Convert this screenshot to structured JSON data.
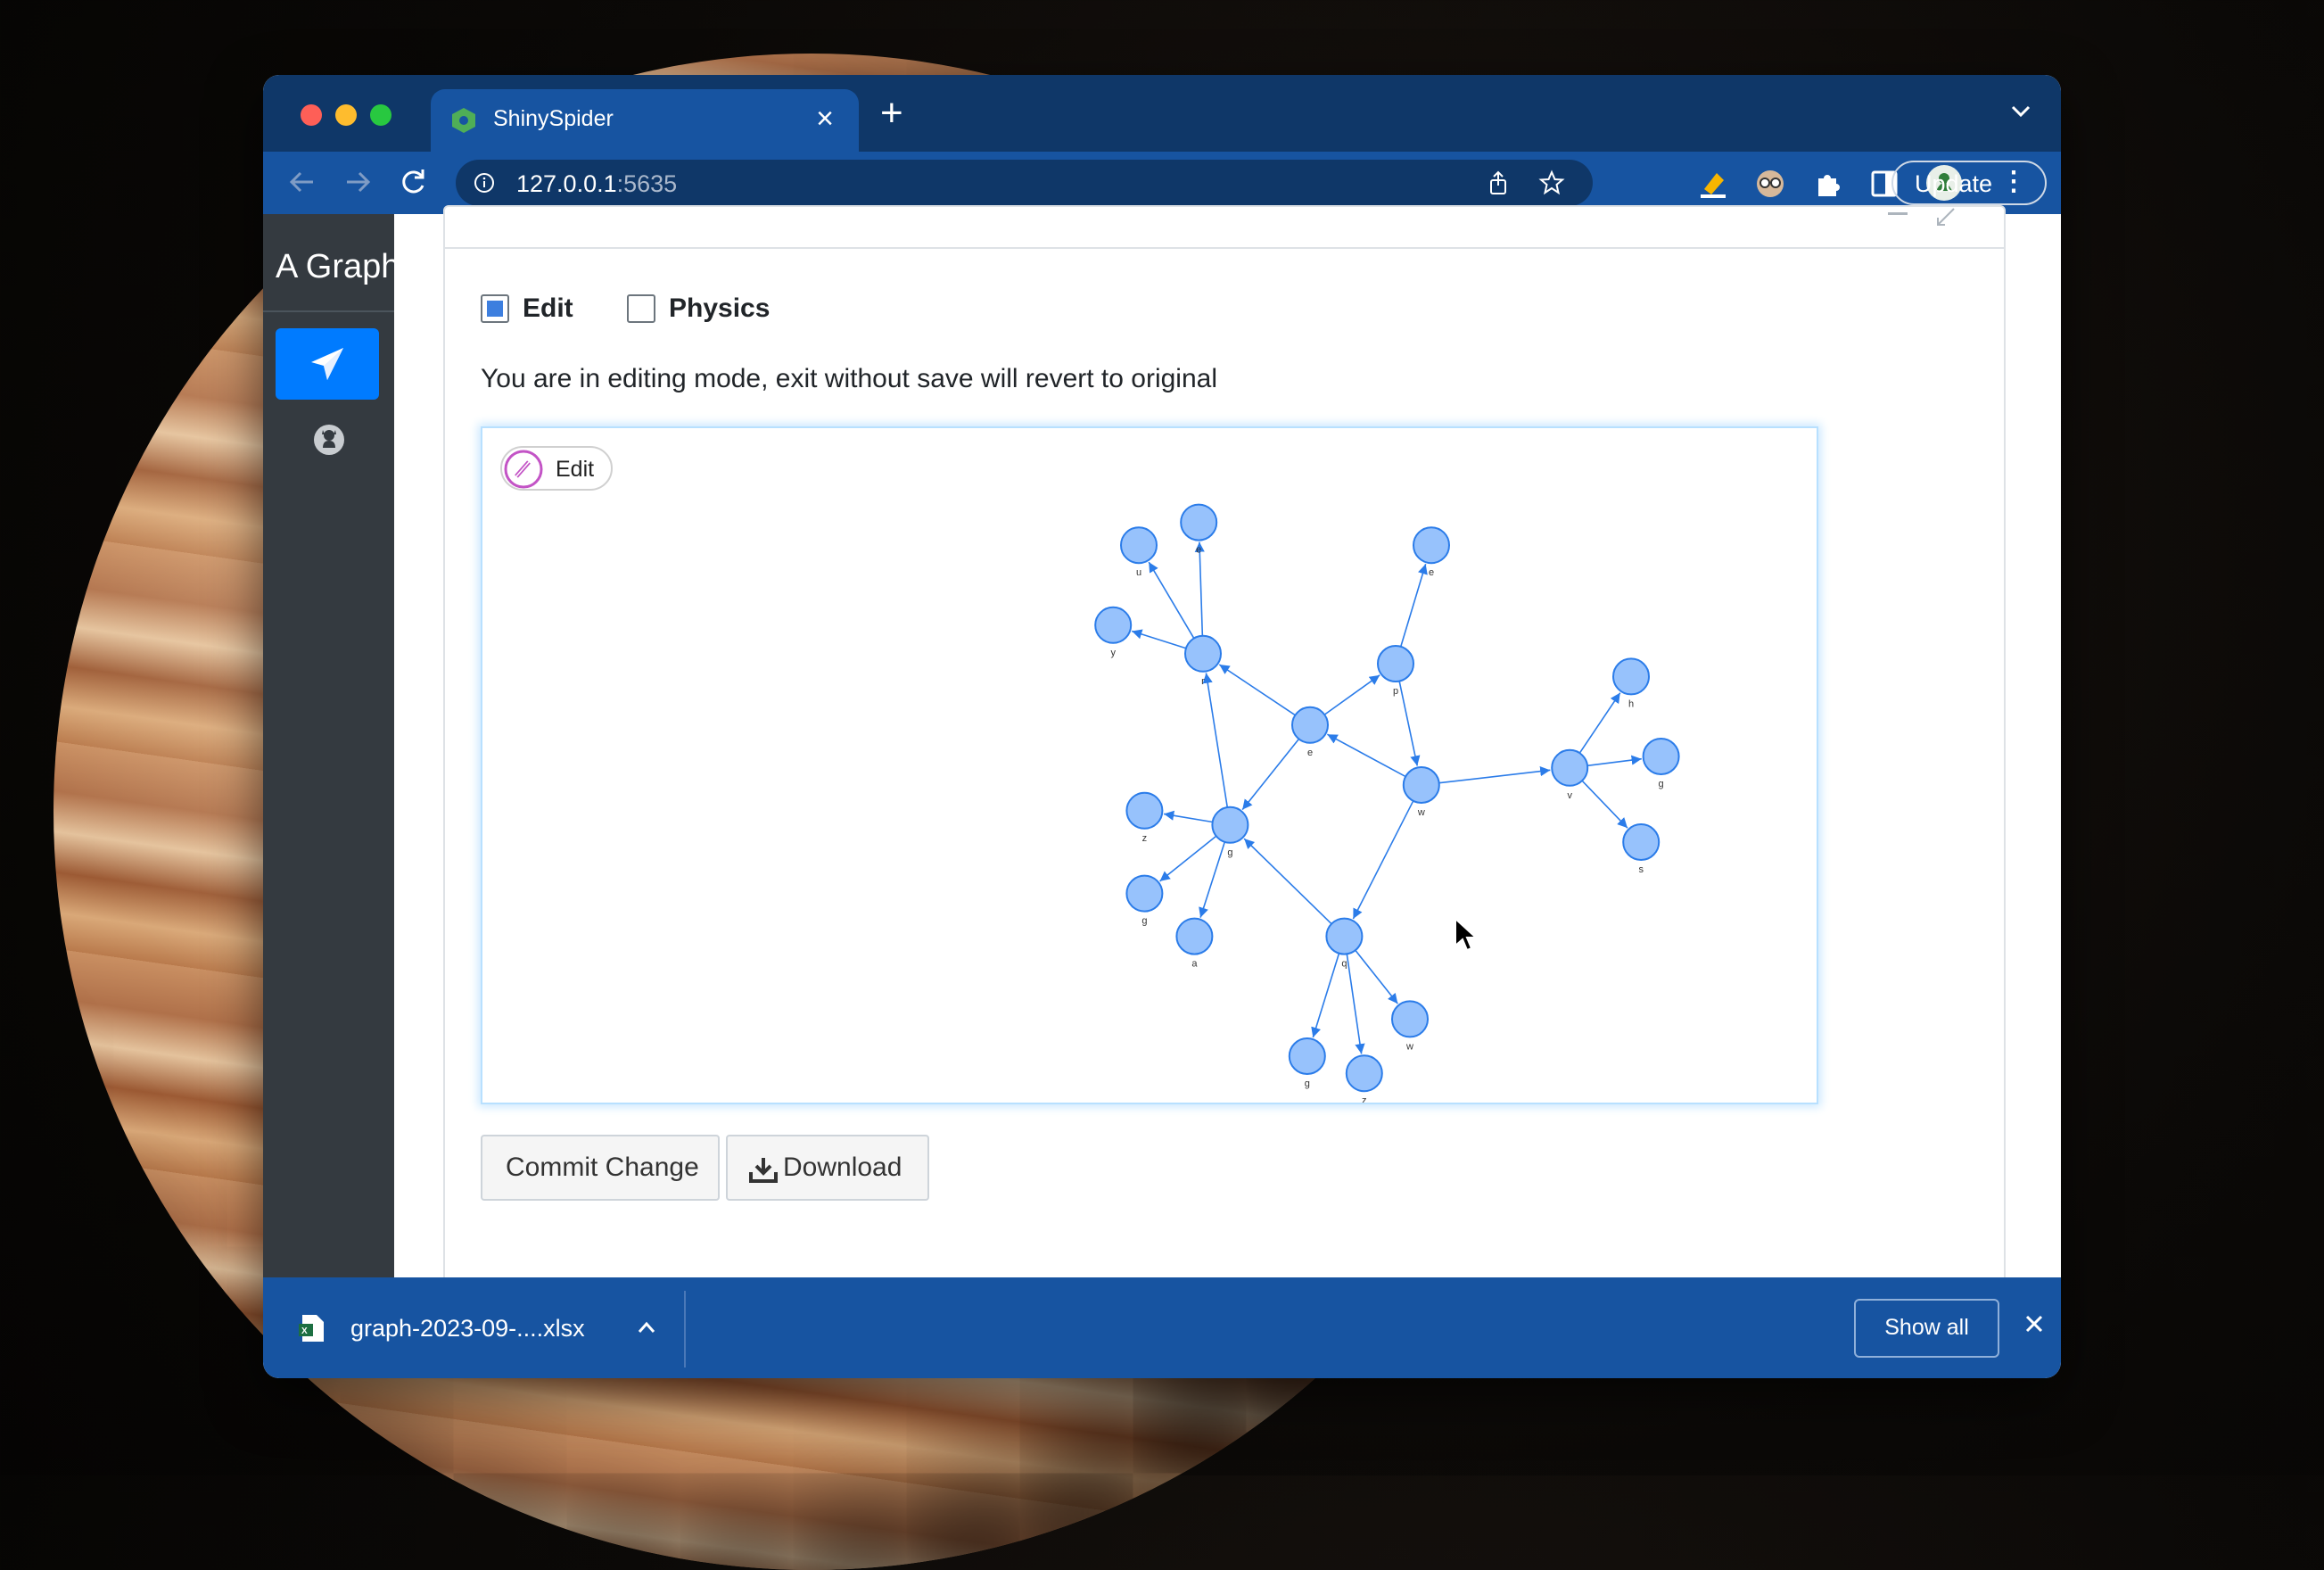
{
  "browser": {
    "tab_title": "ShinySpider",
    "tab_close": "×",
    "new_tab": "+",
    "url_host": "127.0.0.1",
    "url_port": ":5635",
    "update_label": "Update",
    "menu_dots": "⋮"
  },
  "sidebar": {
    "brand": "A Graph",
    "items": [
      {
        "name": "graph",
        "icon": "paper-plane-icon",
        "active": true
      },
      {
        "name": "github",
        "icon": "github-icon",
        "active": false
      }
    ]
  },
  "controls": {
    "edit_label": "Edit",
    "edit_checked": true,
    "physics_label": "Physics",
    "physics_checked": false,
    "edit_message": "You are in editing mode, exit without save will revert to original"
  },
  "graph": {
    "edit_button_label": "Edit",
    "node_color": "#97c2fc",
    "edge_color": "#2b7ce9",
    "nodes": [
      {
        "id": "n1",
        "label": "u"
      },
      {
        "id": "n2",
        "label": "e"
      },
      {
        "id": "n3",
        "label": "e"
      },
      {
        "id": "n4",
        "label": "y"
      },
      {
        "id": "n5",
        "label": "r"
      },
      {
        "id": "n6",
        "label": "p"
      },
      {
        "id": "n7",
        "label": "e"
      },
      {
        "id": "n8",
        "label": "h"
      },
      {
        "id": "n9",
        "label": "w"
      },
      {
        "id": "n10",
        "label": "v"
      },
      {
        "id": "n11",
        "label": "g"
      },
      {
        "id": "n12",
        "label": "z"
      },
      {
        "id": "n13",
        "label": "g"
      },
      {
        "id": "n14",
        "label": "s"
      },
      {
        "id": "n15",
        "label": "g"
      },
      {
        "id": "n16",
        "label": "a"
      },
      {
        "id": "n17",
        "label": "q"
      },
      {
        "id": "n18",
        "label": "w"
      },
      {
        "id": "n19",
        "label": "g"
      },
      {
        "id": "n20",
        "label": "z"
      }
    ],
    "edges": [
      [
        "n5",
        "n1"
      ],
      [
        "n5",
        "n2"
      ],
      [
        "n5",
        "n4"
      ],
      [
        "n7",
        "n5"
      ],
      [
        "n7",
        "n6"
      ],
      [
        "n6",
        "n3"
      ],
      [
        "n6",
        "n9"
      ],
      [
        "n9",
        "n7"
      ],
      [
        "n9",
        "n10"
      ],
      [
        "n10",
        "n8"
      ],
      [
        "n10",
        "n11"
      ],
      [
        "n10",
        "n14"
      ],
      [
        "n7",
        "n13"
      ],
      [
        "n13",
        "n5"
      ],
      [
        "n13",
        "n12"
      ],
      [
        "n13",
        "n15"
      ],
      [
        "n13",
        "n16"
      ],
      [
        "n17",
        "n13"
      ],
      [
        "n9",
        "n17"
      ],
      [
        "n17",
        "n18"
      ],
      [
        "n17",
        "n19"
      ],
      [
        "n17",
        "n20"
      ]
    ]
  },
  "actions": {
    "commit_label": "Commit Change",
    "download_label": "Download"
  },
  "downloads": {
    "file_name": "graph-2023-09-....xlsx",
    "show_all_label": "Show all"
  }
}
